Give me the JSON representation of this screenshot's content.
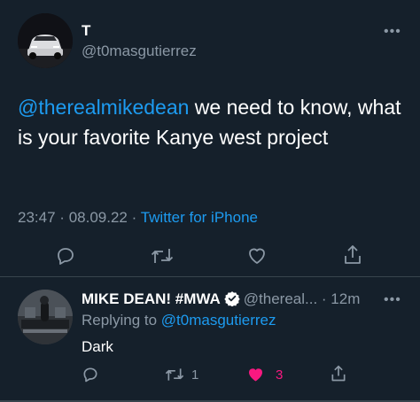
{
  "main_tweet": {
    "name": "T",
    "handle": "@t0masgutierrez",
    "mention": "@therealmikedean",
    "text": " we need to know, what is your favorite Kanye west project",
    "time": "23:47",
    "date": "08.09.22",
    "source": "Twitter for iPhone",
    "more_label": "•••"
  },
  "reply": {
    "name": "MIKE DEAN! #MWA",
    "handle": "@thereal...",
    "time": "12m",
    "replying_prefix": "Replying to ",
    "replying_handle": "@t0masgutierrez",
    "text": "Dark",
    "retweet_count": "1",
    "like_count": "3",
    "more_label": "•••"
  },
  "colors": {
    "background": "#15202b",
    "accent": "#1d9bf0",
    "secondary_text": "#8b98a5",
    "like": "#f91880"
  },
  "icons": {
    "reply": "reply-icon",
    "retweet": "retweet-icon",
    "like": "heart-icon",
    "share": "share-icon",
    "verified": "verified-badge-icon"
  }
}
